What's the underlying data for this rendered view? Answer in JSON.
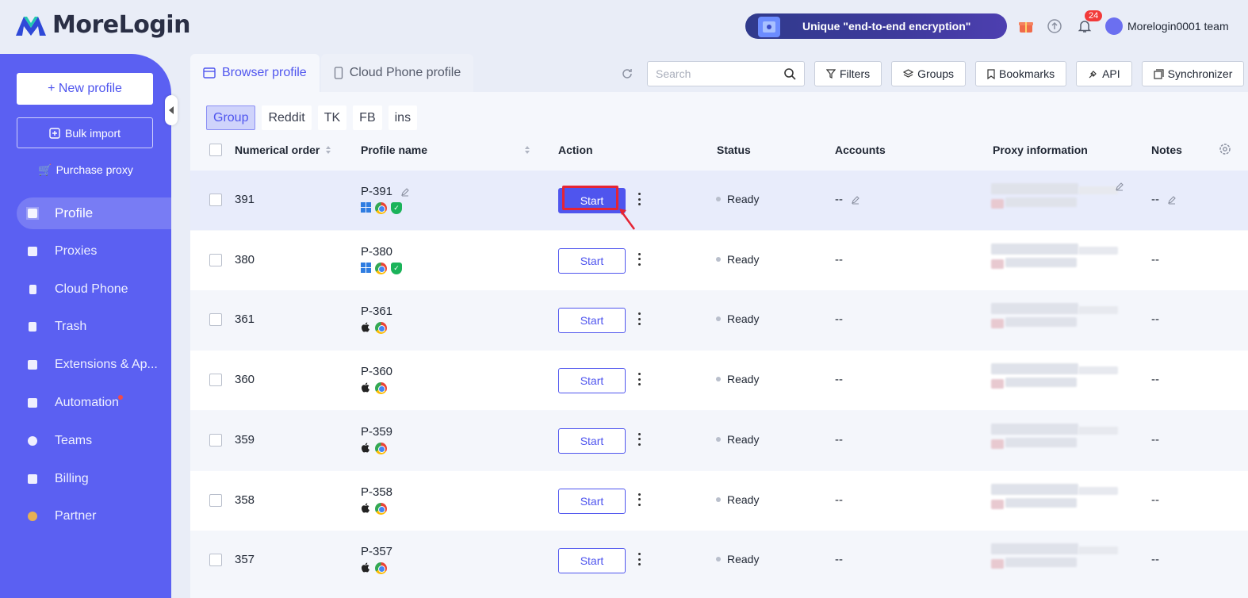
{
  "app": {
    "name": "MoreLogin"
  },
  "header": {
    "banner_text": "Unique \"end-to-end encryption\"",
    "notification_count": "24",
    "team_name": "Morelogin0001 team"
  },
  "sidebar": {
    "new_profile_label": "+ New profile",
    "bulk_import_label": "Bulk import",
    "purchase_proxy_label": "Purchase proxy",
    "items": [
      {
        "label": "Profile",
        "icon": "profile-icon",
        "active": true
      },
      {
        "label": "Proxies",
        "icon": "proxies-icon"
      },
      {
        "label": "Cloud Phone",
        "icon": "cloud-phone-icon"
      },
      {
        "label": "Trash",
        "icon": "trash-icon"
      },
      {
        "label": "Extensions & Ap...",
        "icon": "puzzle-icon"
      },
      {
        "label": "Automation",
        "icon": "robot-icon"
      },
      {
        "label": "Teams",
        "icon": "teams-icon"
      },
      {
        "label": "Billing",
        "icon": "wallet-icon"
      },
      {
        "label": "Partner",
        "icon": "handshake-icon"
      }
    ]
  },
  "tabs": [
    {
      "label": "Browser profile",
      "active": true
    },
    {
      "label": "Cloud Phone profile",
      "active": false
    }
  ],
  "toolbar": {
    "search_placeholder": "Search",
    "filters_label": "Filters",
    "groups_label": "Groups",
    "bookmarks_label": "Bookmarks",
    "api_label": "API",
    "sync_label": "Synchronizer"
  },
  "groups": [
    "Group",
    "Reddit",
    "TK",
    "FB",
    "ins"
  ],
  "table": {
    "headers": {
      "numerical_order": "Numerical order",
      "profile_name": "Profile name",
      "action": "Action",
      "status": "Status",
      "accounts": "Accounts",
      "proxy_information": "Proxy information",
      "notes": "Notes"
    },
    "rows": [
      {
        "order": "391",
        "name": "P-391",
        "os": "windows",
        "shield": true,
        "action": "Start",
        "status": "Ready",
        "accounts": "--",
        "notes": "--"
      },
      {
        "order": "380",
        "name": "P-380",
        "os": "windows",
        "shield": true,
        "action": "Start",
        "status": "Ready",
        "accounts": "--",
        "notes": "--"
      },
      {
        "order": "361",
        "name": "P-361",
        "os": "apple",
        "shield": false,
        "action": "Start",
        "status": "Ready",
        "accounts": "--",
        "notes": "--"
      },
      {
        "order": "360",
        "name": "P-360",
        "os": "apple",
        "shield": false,
        "action": "Start",
        "status": "Ready",
        "accounts": "--",
        "notes": "--"
      },
      {
        "order": "359",
        "name": "P-359",
        "os": "apple",
        "shield": false,
        "action": "Start",
        "status": "Ready",
        "accounts": "--",
        "notes": "--"
      },
      {
        "order": "358",
        "name": "P-358",
        "os": "apple",
        "shield": false,
        "action": "Start",
        "status": "Ready",
        "accounts": "--",
        "notes": "--"
      },
      {
        "order": "357",
        "name": "P-357",
        "os": "apple",
        "shield": false,
        "action": "Start",
        "status": "Ready",
        "accounts": "--",
        "notes": "--"
      }
    ]
  },
  "colors": {
    "accent": "#4f55ee",
    "sidebar": "#5b60f2",
    "highlight": "#e52434"
  }
}
